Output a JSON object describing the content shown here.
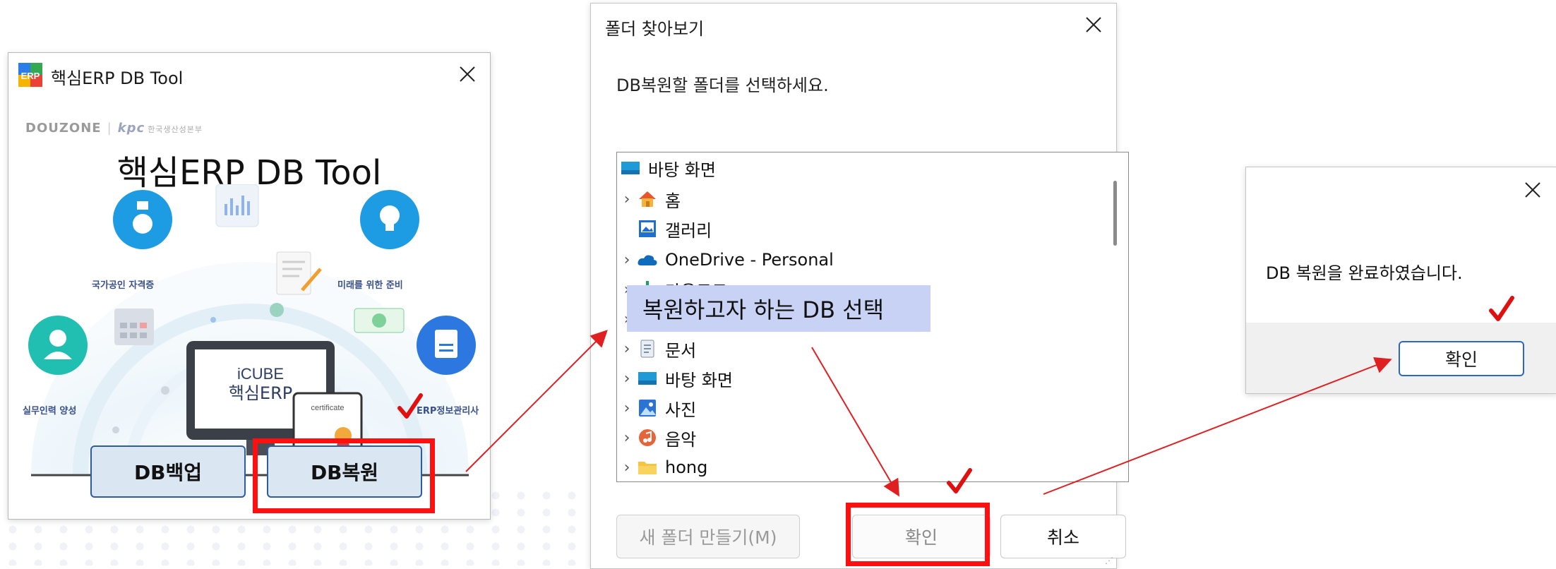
{
  "erp_window": {
    "title": "핵심ERP DB Tool",
    "logo_text": "ERP",
    "brand_douzone": "DOUZONE",
    "brand_kpc": "kpc",
    "brand_kpc_sub": "한국생산성본부",
    "heading": "핵심ERP DB Tool",
    "features": [
      "국가공인 자격증",
      "미래를 위한 준비",
      "실무인력 양성",
      "ERP정보관리사"
    ],
    "monitor_line1": "iCUBE",
    "monitor_line2": "핵심ERP",
    "certificate_label": "certificate",
    "backup_button": "DB백업",
    "restore_button": "DB복원"
  },
  "browse_dialog": {
    "title": "폴더 찾아보기",
    "prompt": "DB복원할 폴더를 선택하세요.",
    "tree": [
      {
        "label": "바탕 화면",
        "icon": "desktop-icon",
        "expandable": false
      },
      {
        "label": "홈",
        "icon": "home-icon",
        "expandable": true
      },
      {
        "label": "갤러리",
        "icon": "gallery-icon",
        "expandable": false
      },
      {
        "label": "OneDrive - Personal",
        "icon": "onedrive-icon",
        "expandable": true
      },
      {
        "label": "다운로드",
        "icon": "download-icon",
        "expandable": true
      },
      {
        "label": "",
        "icon": "",
        "expandable": true
      },
      {
        "label": "문서",
        "icon": "document-icon",
        "expandable": true
      },
      {
        "label": "바탕 화면",
        "icon": "desktop-icon",
        "expandable": true
      },
      {
        "label": "사진",
        "icon": "pictures-icon",
        "expandable": true
      },
      {
        "label": "음악",
        "icon": "music-icon",
        "expandable": true
      },
      {
        "label": "hong",
        "icon": "folder-icon",
        "expandable": true
      }
    ],
    "overlay_caption": "복원하고자 하는 DB 선택",
    "new_folder_button": "새 폴더 만들기(M)",
    "ok_button": "확인",
    "cancel_button": "취소"
  },
  "done_dialog": {
    "message": "DB 복원을 완료하였습니다.",
    "ok_button": "확인"
  },
  "colors": {
    "highlight_red": "#ff1010",
    "arrow_red": "#e02020",
    "button_blue": "#2f5d9c",
    "overlay_blue": "#c8d2f5",
    "check_red": "#e01010"
  }
}
